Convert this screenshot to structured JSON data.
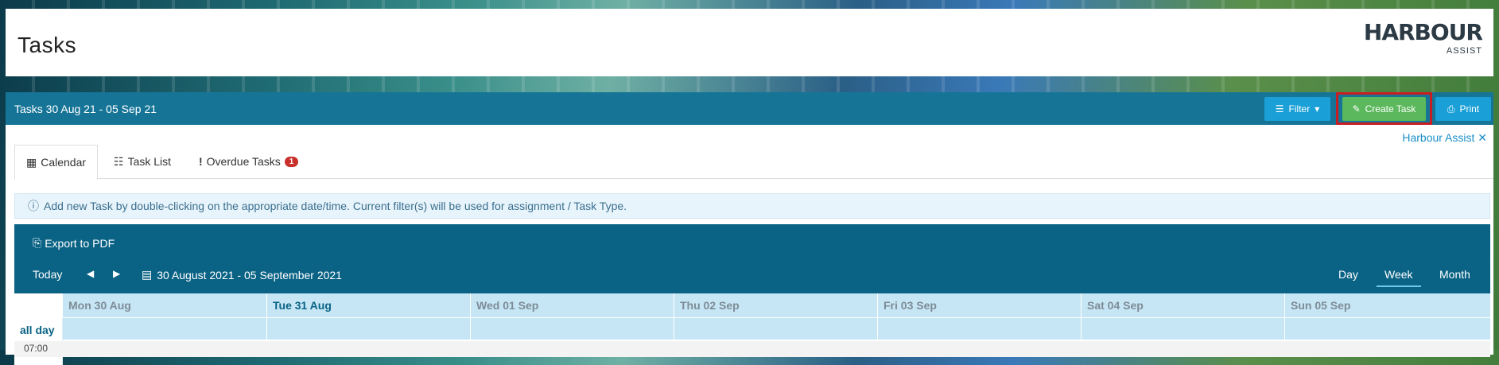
{
  "header": {
    "title": "Tasks"
  },
  "logo": {
    "main": "HARBOUR",
    "sub": "ASSIST"
  },
  "toolbar": {
    "range_title": "Tasks 30 Aug 21 - 05 Sep 21",
    "filter_label": "Filter",
    "create_label": "Create Task",
    "print_label": "Print"
  },
  "link": {
    "harbour_assist": "Harbour Assist ✕"
  },
  "tabs": [
    {
      "label": "Calendar"
    },
    {
      "label": "Task List"
    },
    {
      "label": "Overdue Tasks",
      "badge": "1"
    }
  ],
  "info": {
    "text": "Add new Task by double-clicking on the appropriate date/time. Current filter(s) will be used for assignment / Task Type."
  },
  "calendar": {
    "export_label": "Export to PDF",
    "today_label": "Today",
    "range_label": "30 August 2021 - 05 September 2021",
    "views": [
      "Day",
      "Week",
      "Month"
    ],
    "allday_label": "all day",
    "days": [
      "Mon 30 Aug",
      "Tue 31 Aug",
      "Wed 01 Sep",
      "Thu 02 Sep",
      "Fri 03 Sep",
      "Sat 04 Sep",
      "Sun 05 Sep"
    ],
    "first_time": "07:00"
  },
  "colors": {
    "toolbar": "#167597",
    "calendar_header": "#0a6385",
    "create": "#5cb85c",
    "accent": "#1aa0d6"
  }
}
